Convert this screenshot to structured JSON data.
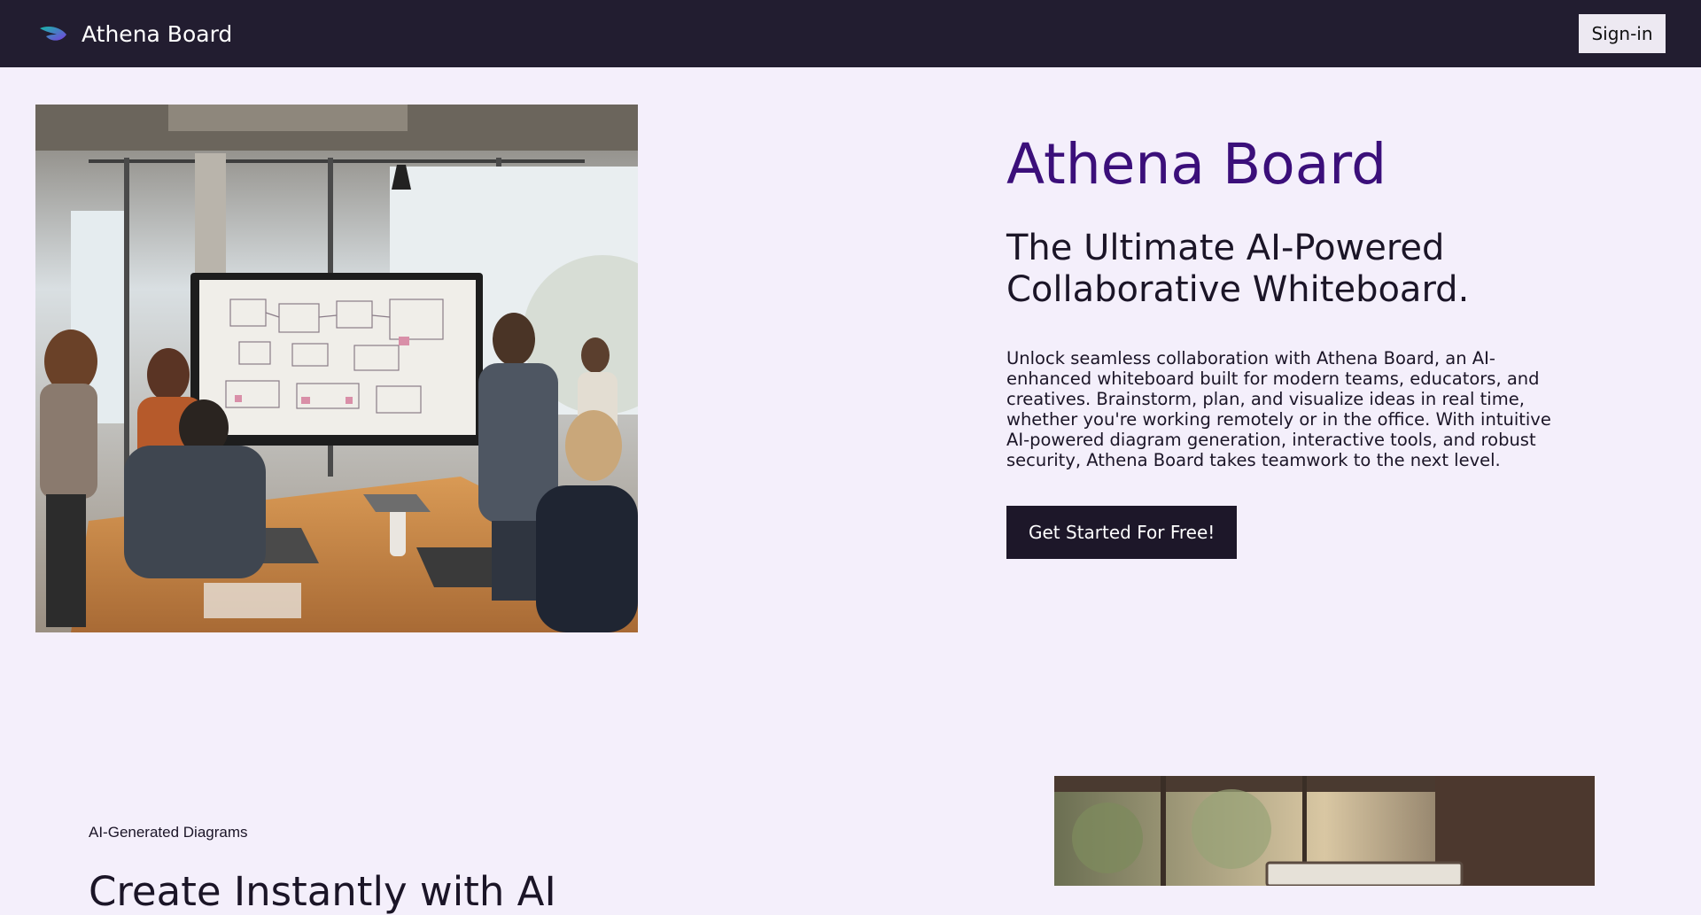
{
  "navbar": {
    "brand_name": "Athena Board",
    "signin_label": "Sign-in",
    "logo_icon": "feather-logo-icon"
  },
  "hero": {
    "title": "Athena Board",
    "subtitle": "The Ultimate AI-Powered Collaborative Whiteboard.",
    "description": "Unlock seamless collaboration with Athena Board, an AI-enhanced whiteboard built for modern teams, educators, and creatives. Brainstorm, plan, and visualize ideas in real time, whether you're working remotely or in the office. With intuitive AI-powered diagram generation, interactive tools, and robust security, Athena Board takes teamwork to the next level.",
    "cta_label": "Get Started For Free!"
  },
  "feature": {
    "tag": "AI-Generated Diagrams",
    "heading": "Create Instantly with AI"
  },
  "colors": {
    "page_background": "#f4effb",
    "navbar_background": "#221d30",
    "hero_title": "#3b0f7a",
    "cta_background": "#1d1729"
  }
}
